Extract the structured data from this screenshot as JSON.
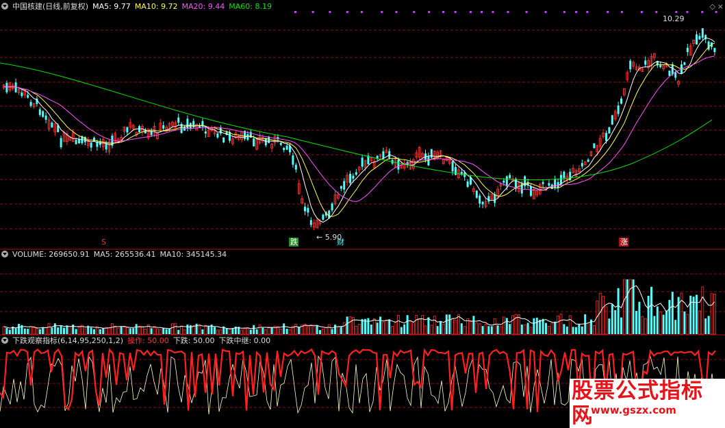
{
  "stock_header": {
    "name": "中国核建(日线,前复权)",
    "ma5": "MA5: 9.77",
    "ma10": "MA10: 9.72",
    "ma20": "MA20: 9.44",
    "ma60": "MA60: 8.19"
  },
  "price_labels": {
    "high": "10.29",
    "low": "5.90"
  },
  "markers": {
    "s": "S",
    "die": "跌",
    "cai": "财",
    "zhang": "涨"
  },
  "volume_header": {
    "volume": "VOLUME: 269650.91",
    "ma5": "MA5: 265536.41",
    "ma10": "MA10: 345145.34"
  },
  "indicator_header": {
    "name": "下跌观察指标(6,14,95,250,1,2)",
    "op": "操作: 50.00",
    "down": "下跌: 50.00",
    "relay": "下跌中继: 0.00"
  },
  "corner_icons": [
    "diamond-icon",
    "close-icon"
  ],
  "watermark": {
    "title": "股票公式指标网",
    "url": "www.gszx.com"
  },
  "colors": {
    "up": "#ff3232",
    "down": "#54fcfc",
    "ma5": "#ffffff",
    "ma10": "#ffff54",
    "ma20": "#ff54ff",
    "ma60": "#00e600",
    "grid": "#8a1010",
    "indicator": "#ff2020"
  }
}
